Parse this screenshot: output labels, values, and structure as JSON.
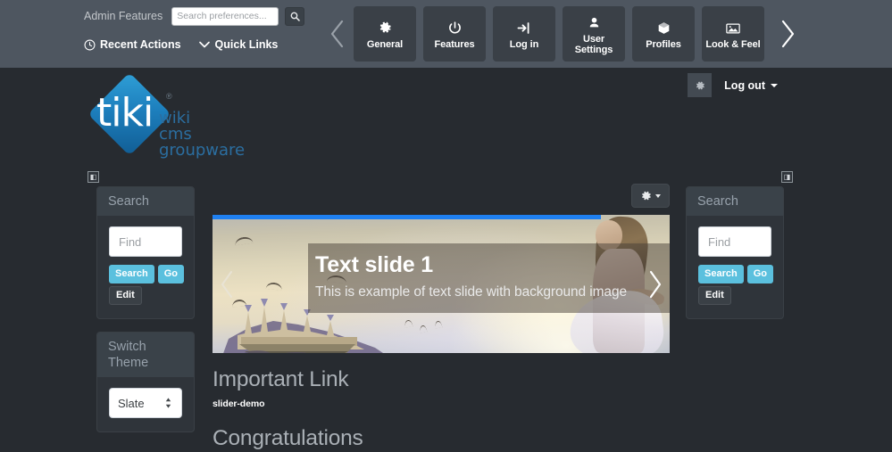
{
  "admin_bar": {
    "features_label": "Admin Features",
    "search": {
      "placeholder": "Search preferences...",
      "value": "",
      "button_icon": "search-icon"
    },
    "links": [
      {
        "label": "Recent Actions",
        "icon": "clock-icon"
      },
      {
        "label": "Quick Links",
        "icon": "chevron-down-icon"
      }
    ],
    "prev_arrow": "‹",
    "next_arrow": "›",
    "tiles": [
      {
        "label": "General",
        "icon": "gear-icon"
      },
      {
        "label": "Features",
        "icon": "power-icon"
      },
      {
        "label": "Log in",
        "icon": "login-arrow-icon"
      },
      {
        "label": "User\nSettings",
        "icon": "user-icon",
        "line1": "User",
        "line2": "Settings"
      },
      {
        "label": "Profiles",
        "icon": "box-icon"
      },
      {
        "label": "Look & Feel",
        "icon": "image-icon"
      }
    ]
  },
  "site_header": {
    "logo": {
      "wordmark": "tiki",
      "registered": "®",
      "tagline_lines": [
        "wiki",
        "cms",
        "groupware"
      ]
    },
    "logout": {
      "gear_icon": "gear-icon",
      "label": "Log out"
    }
  },
  "columns": {
    "left_toggle_icon": "◧",
    "right_toggle_icon": "◨"
  },
  "modules": {
    "search_left": {
      "title": "Search",
      "input_placeholder": "Find",
      "input_value": "",
      "search_label": "Search",
      "go_label": "Go",
      "edit_label": "Edit"
    },
    "switch_theme": {
      "title": "Switch Theme",
      "selected": "Slate",
      "options": [
        "Slate"
      ]
    },
    "search_right": {
      "title": "Search",
      "input_placeholder": "Find",
      "input_value": "",
      "search_label": "Search",
      "go_label": "Go",
      "edit_label": "Edit"
    }
  },
  "slider": {
    "gear_icon": "gear-icon",
    "progress_percent": 85,
    "slide_title": "Text slide 1",
    "slide_desc": "This is example of text slide with background image",
    "prev_arrow": "‹",
    "next_arrow": "›",
    "accent_color": "#1f80f0"
  },
  "content": {
    "important_link_heading": "Important Link",
    "slider_demo_tag": "slider-demo",
    "congratulations_heading": "Congratulations"
  },
  "colors": {
    "admin_bar_bg": "#4e5660",
    "page_bg": "#272b30",
    "module_bg": "#2f343a",
    "module_header_bg": "#3a4249",
    "btn_cyan": "#5bc0de",
    "logo_blue": "#2b6ea0"
  }
}
